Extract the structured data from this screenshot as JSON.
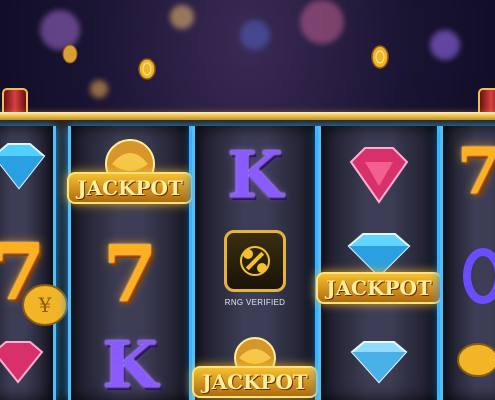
{
  "reels": {
    "reel1": {
      "jackpot": "JACKPOT"
    },
    "reel2": {
      "jackpot": "JACKPOT",
      "seven": "7",
      "king": "K"
    },
    "reel3": {
      "king": "K",
      "rng_label": "RNG VERIFIED",
      "jackpot": "JACKPOT"
    },
    "reel4": {
      "jackpot": "JACKPOT"
    },
    "reel5": {
      "seven": "7"
    }
  },
  "left_partial": {
    "seven": "7"
  },
  "colors": {
    "gold": "#f5c030",
    "reel_glow": "#4fc0ff",
    "seven": "#ffb020",
    "king": "#8a5cff"
  },
  "icons": [
    "diamond-icon",
    "ruby-icon",
    "gold-coin-icon",
    "dragon-emblem-icon",
    "rng-logo-icon"
  ]
}
